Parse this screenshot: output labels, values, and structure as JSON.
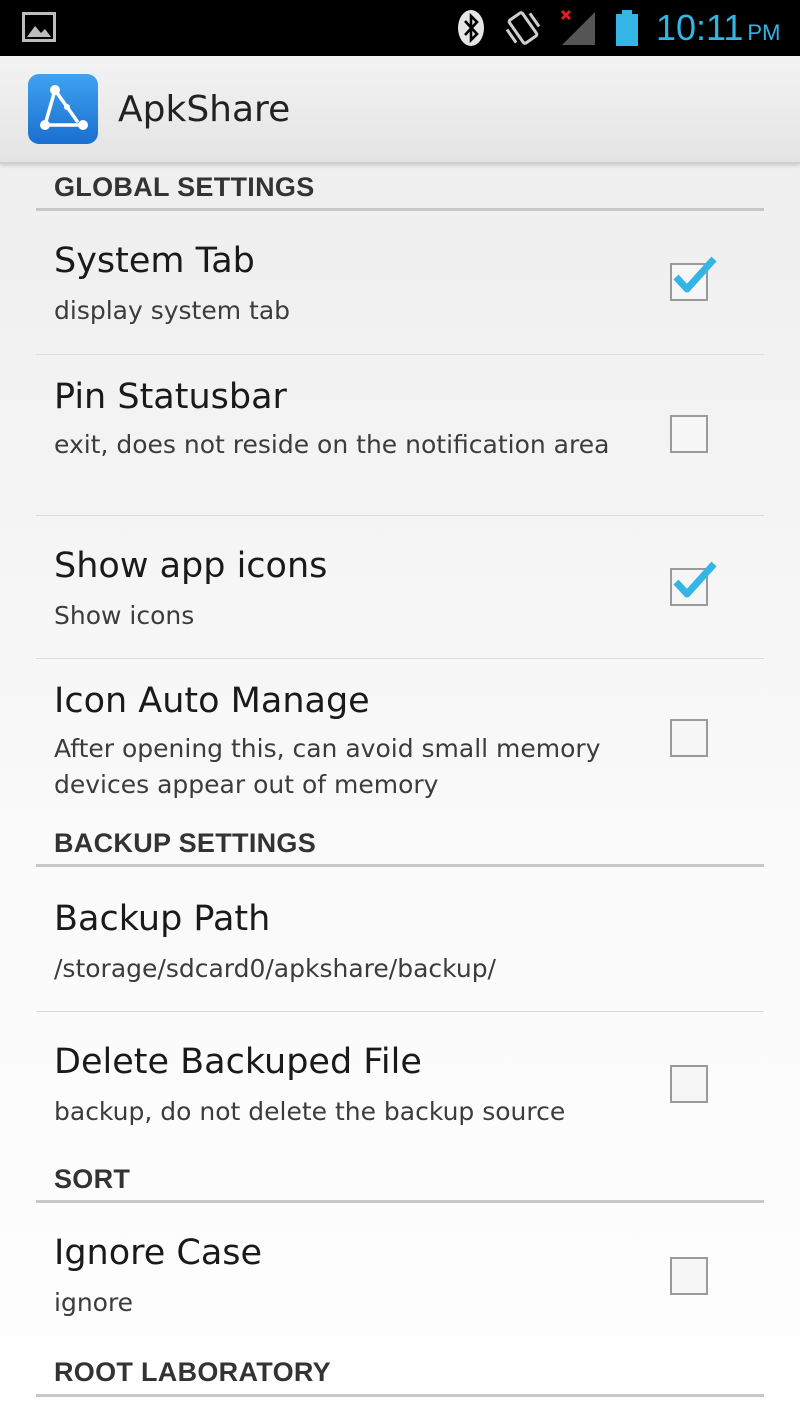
{
  "status_bar": {
    "time": "10:11",
    "ampm": "PM",
    "icons": [
      "gallery-icon",
      "bluetooth-icon",
      "vibrate-icon",
      "signal-icon",
      "battery-icon"
    ],
    "accent_color": "#33b5e5"
  },
  "action_bar": {
    "title": "ApkShare",
    "icon": "apkshare-logo-icon",
    "icon_color": "#2a8ce0"
  },
  "sections": [
    {
      "header": "GLOBAL SETTINGS",
      "items": [
        {
          "title": "System Tab",
          "summary": "display system tab",
          "checked": true
        },
        {
          "title": "Pin Statusbar",
          "summary": "exit, does not reside on the notification area",
          "checked": false
        },
        {
          "title": "Show app icons",
          "summary": "Show icons",
          "checked": true
        },
        {
          "title": "Icon Auto Manage",
          "summary": "After opening this, can avoid small memory devices appear out of memory",
          "checked": false
        }
      ]
    },
    {
      "header": "BACKUP SETTINGS",
      "items": [
        {
          "title": "Backup Path",
          "summary": "/storage/sdcard0/apkshare/backup/"
        },
        {
          "title": "Delete Backuped File",
          "summary": "backup, do not delete the backup source",
          "checked": false
        }
      ]
    },
    {
      "header": "SORT",
      "items": [
        {
          "title": "Ignore Case",
          "summary": "ignore",
          "checked": false
        }
      ]
    },
    {
      "header": "ROOT LABORATORY",
      "items": []
    }
  ],
  "check_color": "#33b5e5"
}
